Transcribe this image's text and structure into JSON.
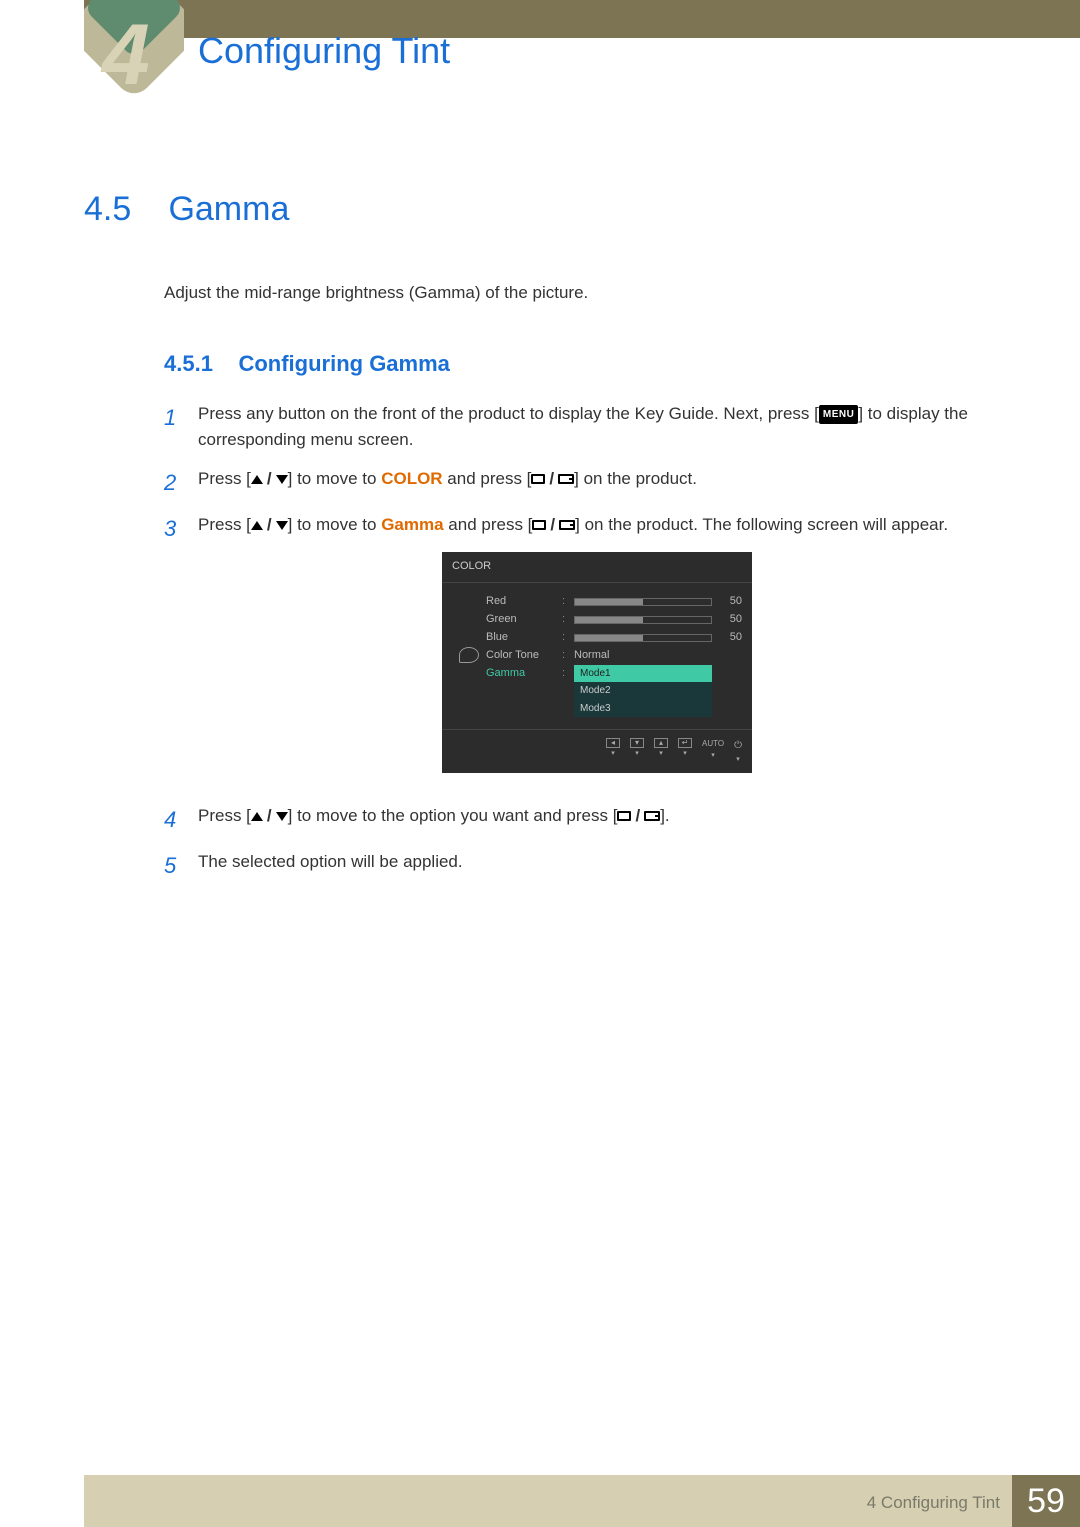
{
  "chapter_number_decor": "4",
  "page_title": "Configuring Tint",
  "section": {
    "num": "4.5",
    "title": "Gamma"
  },
  "intro": "Adjust the mid-range brightness (Gamma) of the picture.",
  "subsection": {
    "num": "4.5.1",
    "title": "Configuring Gamma"
  },
  "steps": {
    "s1": {
      "num": "1",
      "pre": "Press any button on the front of the product to display the Key Guide. Next, press [",
      "menu": "MENU",
      "post": "] to display the corresponding menu screen."
    },
    "s2": {
      "num": "2",
      "a": "Press [",
      "b": "] to move to ",
      "kw": "COLOR",
      "c": " and press [",
      "d": "] on the product."
    },
    "s3": {
      "num": "3",
      "a": "Press [",
      "b": "] to move to ",
      "kw": "Gamma",
      "c": " and press [",
      "d": "] on the product. The following screen will appear."
    },
    "s4": {
      "num": "4",
      "a": "Press [",
      "b": "] to move to the option you want and press [",
      "c": "]."
    },
    "s5": {
      "num": "5",
      "text": "The selected option will be applied."
    }
  },
  "osd": {
    "title": "COLOR",
    "rows": {
      "red": {
        "label": "Red",
        "value": "50",
        "fill": 50
      },
      "green": {
        "label": "Green",
        "value": "50",
        "fill": 50
      },
      "blue": {
        "label": "Blue",
        "value": "50",
        "fill": 50
      },
      "color_tone": {
        "label": "Color Tone",
        "value": "Normal"
      },
      "gamma": {
        "label": "Gamma",
        "options": [
          "Mode1",
          "Mode2",
          "Mode3"
        ],
        "selected": "Mode1"
      }
    },
    "nav": {
      "auto": "AUTO"
    }
  },
  "footer": {
    "caption_num": "4",
    "caption_title": "Configuring Tint",
    "page_num": "59"
  }
}
